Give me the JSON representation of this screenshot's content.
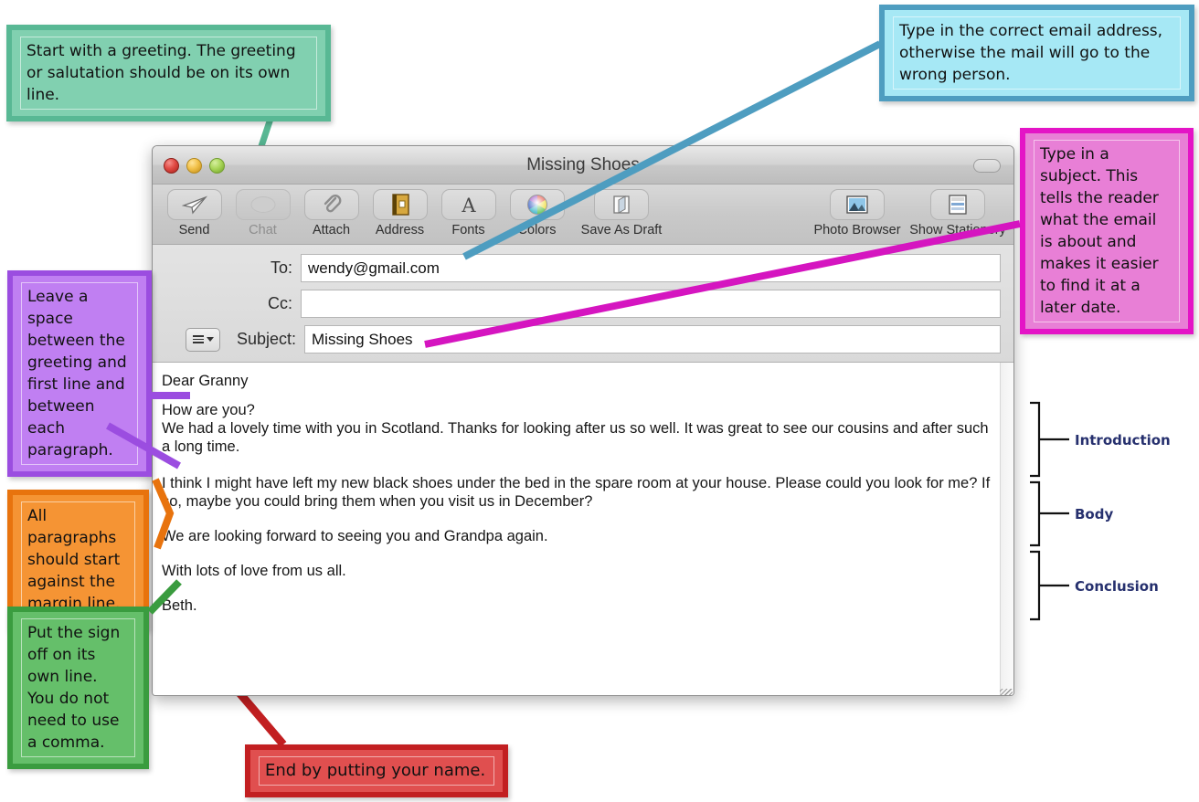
{
  "window": {
    "title": "Missing Shoes",
    "traffic_lights": [
      "close-red",
      "minimize-yellow",
      "zoom-green"
    ]
  },
  "toolbar": {
    "left_items": [
      {
        "label": "Send",
        "icon": "send-paper-plane-icon",
        "disabled": false
      },
      {
        "label": "Chat",
        "icon": "chat-bubble-icon",
        "disabled": true
      },
      {
        "label": "Attach",
        "icon": "paperclip-icon",
        "disabled": false
      },
      {
        "label": "Address",
        "icon": "address-book-icon",
        "disabled": false
      },
      {
        "label": "Fonts",
        "icon": "font-a-icon",
        "disabled": false
      },
      {
        "label": "Colors",
        "icon": "color-wheel-icon",
        "disabled": false
      },
      {
        "label": "Save As Draft",
        "icon": "save-draft-icon",
        "disabled": false
      }
    ],
    "right_items": [
      {
        "label": "Photo Browser",
        "icon": "photo-browser-icon",
        "disabled": false
      },
      {
        "label": "Show Stationery",
        "icon": "show-stationery-icon",
        "disabled": false
      }
    ]
  },
  "headers": {
    "to_label": "To:",
    "to_value": "wendy@gmail.com",
    "cc_label": "Cc:",
    "cc_value": "",
    "subject_label": "Subject:",
    "subject_value": "Missing Shoes",
    "header_menu_icon": "hamburger-menu-icon"
  },
  "message_body": {
    "greeting": "Dear Granny",
    "paragraphs": [
      "How are you?",
      "We had a lovely time with you in Scotland. Thanks for looking after us so well. It was great to see our cousins and after such a long time.",
      "I think I might have left my new black shoes under the bed in the spare room at your house. Please could you look for me? If so, maybe you could bring them when you visit us in December?",
      "We are looking forward to seeing you and Grandpa again.",
      "With lots of love from us all.",
      "Beth."
    ]
  },
  "callouts": {
    "greeting_note": "Start with a greeting. The greeting or salutation should be on its own line.",
    "address_note": "Type in the correct email address, otherwise the mail will go to the wrong person.",
    "subject_note": "Type in a subject. This tells the reader what the email is about and makes it easier to find it at a later date.",
    "spacing_note": "Leave a space between the greeting and first line and between each paragraph.",
    "margin_note": "All paragraphs should start against the margin line.",
    "signoff_note": "Put the sign off on its own line. You do not need to use a comma.",
    "name_note": "End by putting your name."
  },
  "section_labels": {
    "introduction": "Introduction",
    "body": "Body",
    "conclusion": "Conclusion"
  },
  "colors": {
    "green_callout_fill": "#81d0b0",
    "green_callout_border": "#58b894",
    "cyan_callout_fill": "#a6e8f5",
    "cyan_callout_border": "#4e9dc0",
    "pink_callout_fill": "#e87fd6",
    "pink_callout_border": "#e414c6",
    "purple_callout_fill": "#c07ff2",
    "purple_callout_border": "#9b4de0",
    "orange_callout_fill": "#f59434",
    "orange_callout_border": "#e8730d",
    "green2_callout_fill": "#65bf6a",
    "green2_callout_border": "#3a9c3f",
    "red_callout_fill": "#e04f4f",
    "red_callout_border": "#c21f21",
    "section_label_color": "#26306e"
  }
}
